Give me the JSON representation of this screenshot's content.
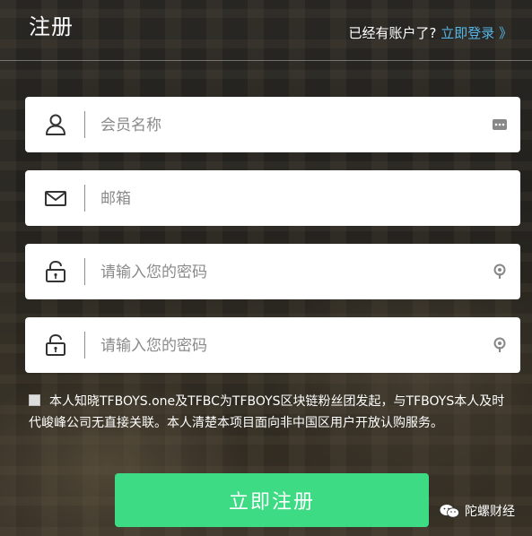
{
  "header": {
    "title": "注册",
    "has_account_text": "已经有账户了?",
    "login_link": "立即登录 》"
  },
  "form": {
    "username": {
      "placeholder": "会员名称",
      "icon": "user-icon",
      "tail_icon": "autofill-icon"
    },
    "email": {
      "placeholder": "邮箱",
      "icon": "mail-icon"
    },
    "password": {
      "placeholder": "请输入您的密码",
      "icon": "lock-icon",
      "tail_icon": "key-icon"
    },
    "password_confirm": {
      "placeholder": "请输入您的密码",
      "icon": "lock-icon",
      "tail_icon": "key-icon"
    }
  },
  "agreement": {
    "text": "本人知晓TFBOYS.one及TFBC为TFBOYS区块链粉丝团发起，与TFBOYS本人及时代峻峰公司无直接关联。本人清楚本项目面向非中国区用户开放认购服务。"
  },
  "submit": {
    "label": "立即注册",
    "color": "#3ddc84"
  },
  "watermark": {
    "text": "陀螺财经"
  },
  "colors": {
    "link": "#56b7e6",
    "accent": "#3ddc84"
  }
}
